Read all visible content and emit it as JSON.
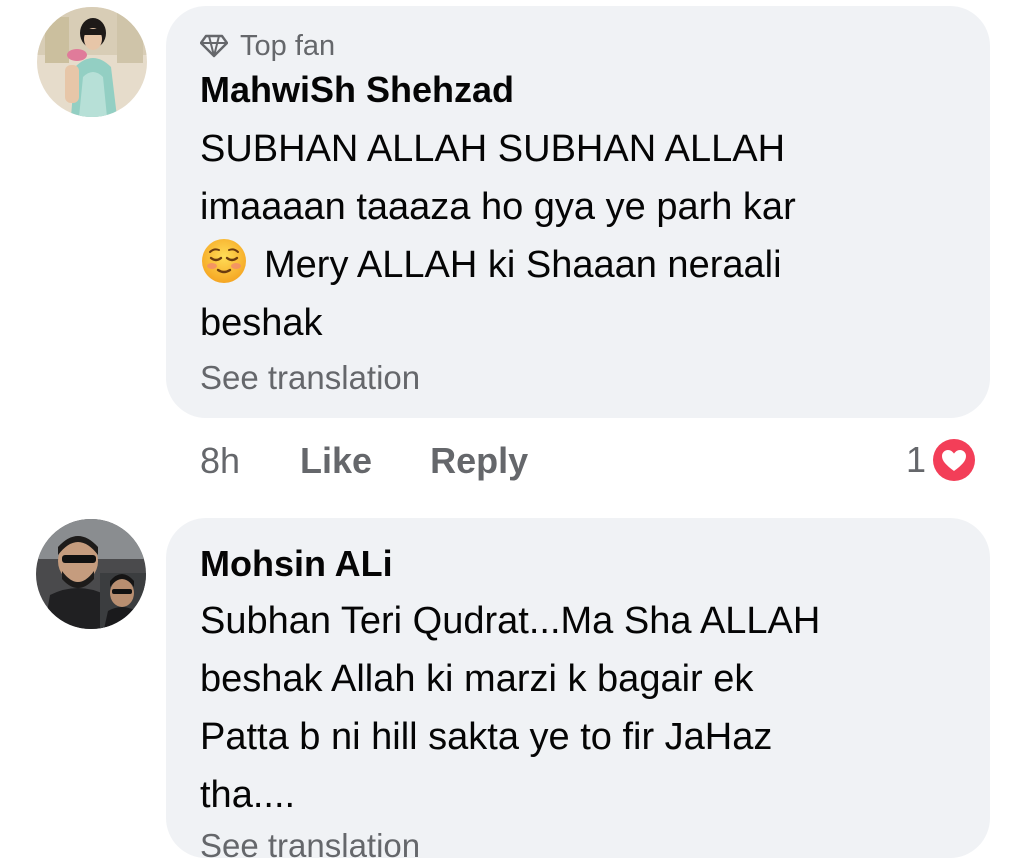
{
  "comments": [
    {
      "badge": "Top fan",
      "author": "MahwiSh Shehzad",
      "lines": [
        "SUBHAN ALLAH SUBHAN ALLAH",
        "imaaaan taaaza ho gya ye parh kar",
        "Mery ALLAH ki Shaaan neraali",
        "beshak"
      ],
      "see_translation": "See translation",
      "time": "8h",
      "like": "Like",
      "reply": "Reply",
      "reaction_count": "1"
    },
    {
      "author": "Mohsin ALi",
      "lines": [
        "Subhan Teri Qudrat...Ma Sha ALLAH",
        "beshak Allah ki marzi k bagair ek",
        "Patta b ni hill sakta ye to fir JaHaz",
        "tha...."
      ],
      "see_translation": "See translation"
    }
  ],
  "colors": {
    "bubble": "#f0f2f5",
    "secondary_text": "#65676b",
    "heart": "#f33e58"
  },
  "icons": {
    "badge": "diamond-icon",
    "emoji": "relieved-face-emoji-icon",
    "reaction": "love-reaction-icon"
  }
}
